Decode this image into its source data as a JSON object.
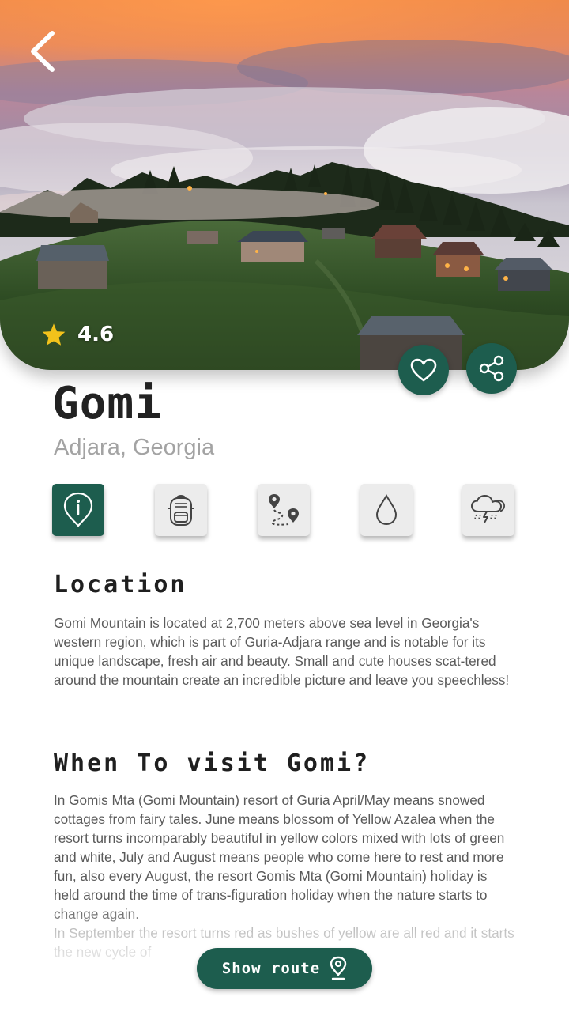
{
  "hero": {
    "rating": "4.6",
    "back_icon": "chevron-left-icon",
    "rating_icon": "star-icon"
  },
  "actions": {
    "favorite_icon": "heart-icon",
    "share_icon": "share-icon"
  },
  "place": {
    "title": "Gomi",
    "subtitle": "Adjara, Georgia"
  },
  "tabs": [
    {
      "icon": "info-pin-icon",
      "active": true
    },
    {
      "icon": "backpack-icon",
      "active": false
    },
    {
      "icon": "route-map-icon",
      "active": false
    },
    {
      "icon": "water-drop-icon",
      "active": false
    },
    {
      "icon": "weather-storm-icon",
      "active": false
    }
  ],
  "sections": {
    "location": {
      "title": "Location",
      "body": "Gomi Mountain is located at 2,700 meters above sea level in Georgia's western region, which is part of Guria-Adjara range and is notable for its unique landscape, fresh air and beauty. Small and cute houses scat-tered around the mountain create an incredible picture and leave you speechless!"
    },
    "when": {
      "title": "When To visit Gomi?",
      "body": "In Gomis Mta (Gomi Mountain) resort of Guria April/May means snowed cottages from fairy tales. June means blossom of Yellow Azalea when the resort turns incomparably beautiful in yellow colors mixed with lots of green and white, July and August means people who come here to rest and more fun, also every August, the resort Gomis Mta (Gomi Mountain) holiday is held around the time of trans-figuration holiday when the nature starts to change again.",
      "body_continued": "In September the resort turns red as bushes of yellow are all red and it starts the new cycle of"
    }
  },
  "route_button": {
    "label": "Show route",
    "icon": "map-pin-icon"
  },
  "colors": {
    "accent": "#1d5d4e",
    "tab_bg": "#ececec",
    "title": "#222222",
    "subtitle": "#a3a3a3",
    "body": "#5a5a5a",
    "star": "#f2c21b"
  }
}
